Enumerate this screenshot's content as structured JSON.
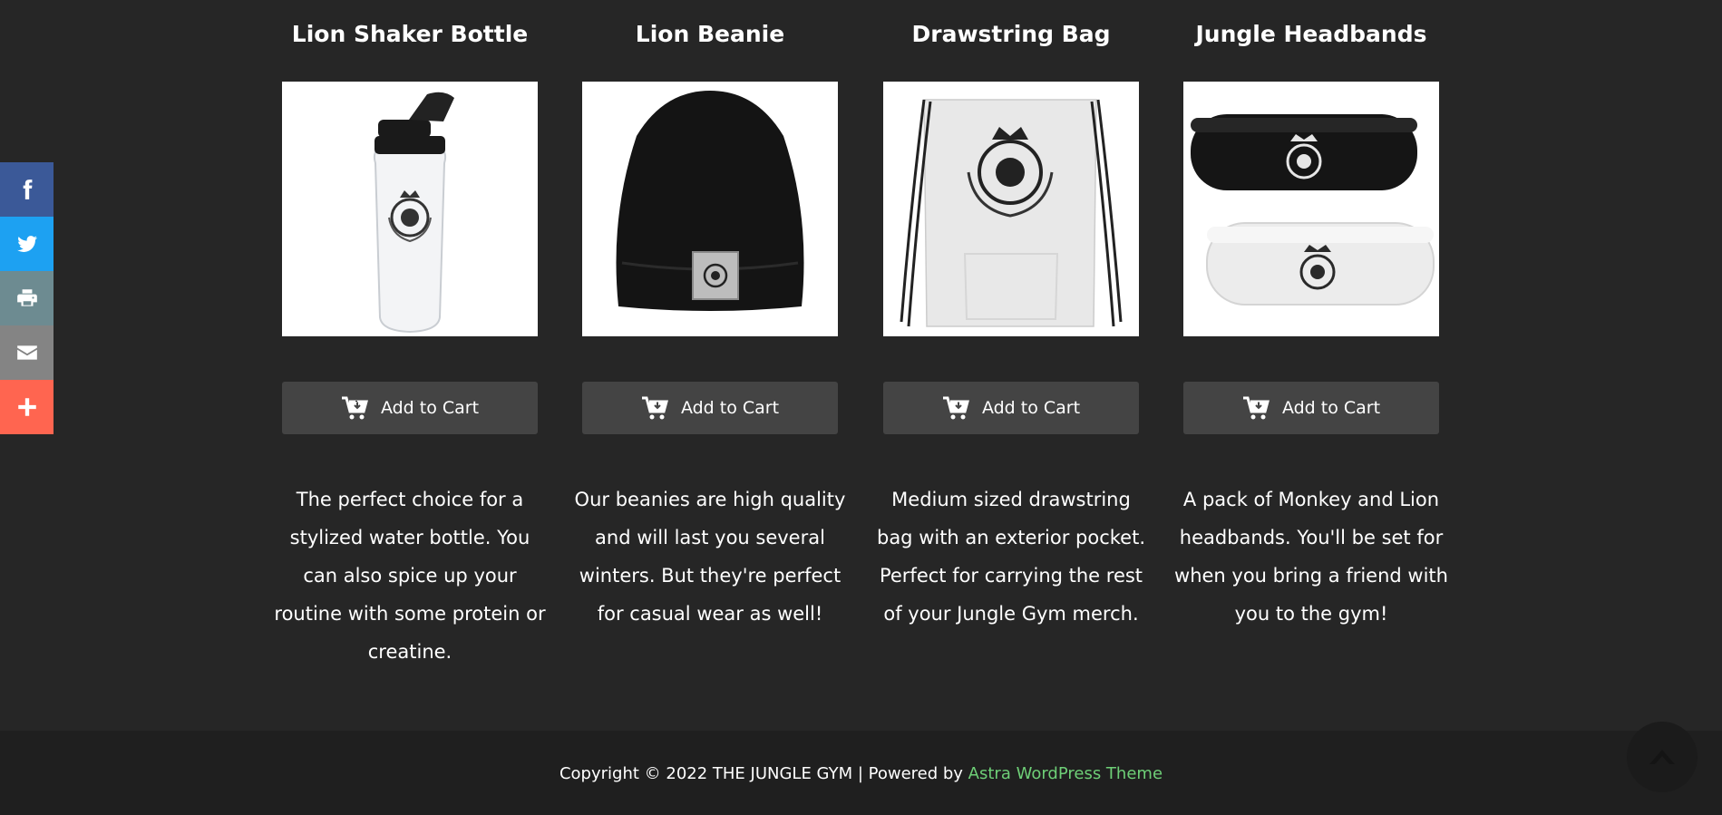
{
  "products": [
    {
      "title": "Lion Shaker Bottle",
      "button_label": "Add to Cart",
      "description": "The perfect choice for a stylized water bottle. You can also spice up your routine with some protein or creatine."
    },
    {
      "title": "Lion Beanie",
      "button_label": "Add to Cart",
      "description": "Our beanies are high quality and will last you several winters. But they're perfect for casual wear as well!"
    },
    {
      "title": "Drawstring Bag",
      "button_label": "Add to Cart",
      "description": "Medium sized drawstring bag with an exterior pocket. Perfect for carrying the rest of your Jungle Gym merch."
    },
    {
      "title": "Jungle Headbands",
      "button_label": "Add to Cart",
      "description": "A pack of Monkey and Lion headbands. You'll be set for when you bring a friend with you to the gym!"
    }
  ],
  "share_bar": {
    "items": [
      {
        "icon": "facebook-icon",
        "color": "#3b5998"
      },
      {
        "icon": "twitter-icon",
        "color": "#1da1f2"
      },
      {
        "icon": "print-icon",
        "color": "#6d8b91"
      },
      {
        "icon": "email-icon",
        "color": "#848484"
      },
      {
        "icon": "plus-icon",
        "color": "#ff6550"
      }
    ]
  },
  "footer": {
    "copyright": "Copyright © 2022 THE JUNGLE GYM | Powered by ",
    "theme_link": "Astra WordPress Theme",
    "link_color": "#6ecf77"
  },
  "colors": {
    "background": "#262626",
    "footer_bg": "#1f1f1f",
    "button_bg": "#444444"
  }
}
